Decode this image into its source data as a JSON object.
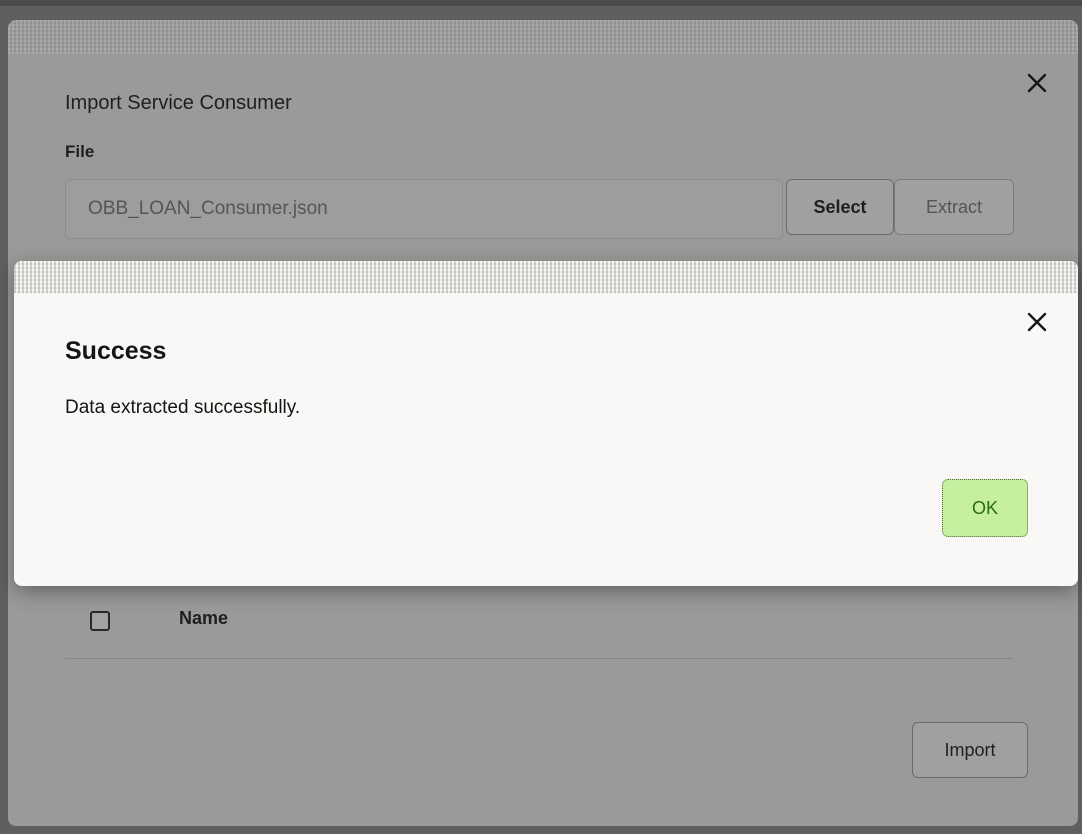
{
  "import_dialog": {
    "title": "Import Service Consumer",
    "file_label": "File",
    "file_value": "OBB_LOAN_Consumer.json",
    "select_label": "Select",
    "extract_label": "Extract",
    "table_header_name": "Name",
    "import_label": "Import"
  },
  "success_dialog": {
    "title": "Success",
    "message": "Data extracted successfully.",
    "ok_label": "OK"
  },
  "colors": {
    "ok_button_bg": "#c6f0a0",
    "ok_button_text": "#2f6a12",
    "dialog_bg": "#f9f8f6",
    "overlay_dim": "#9a9a99"
  },
  "icons": {
    "close": "close-icon"
  }
}
